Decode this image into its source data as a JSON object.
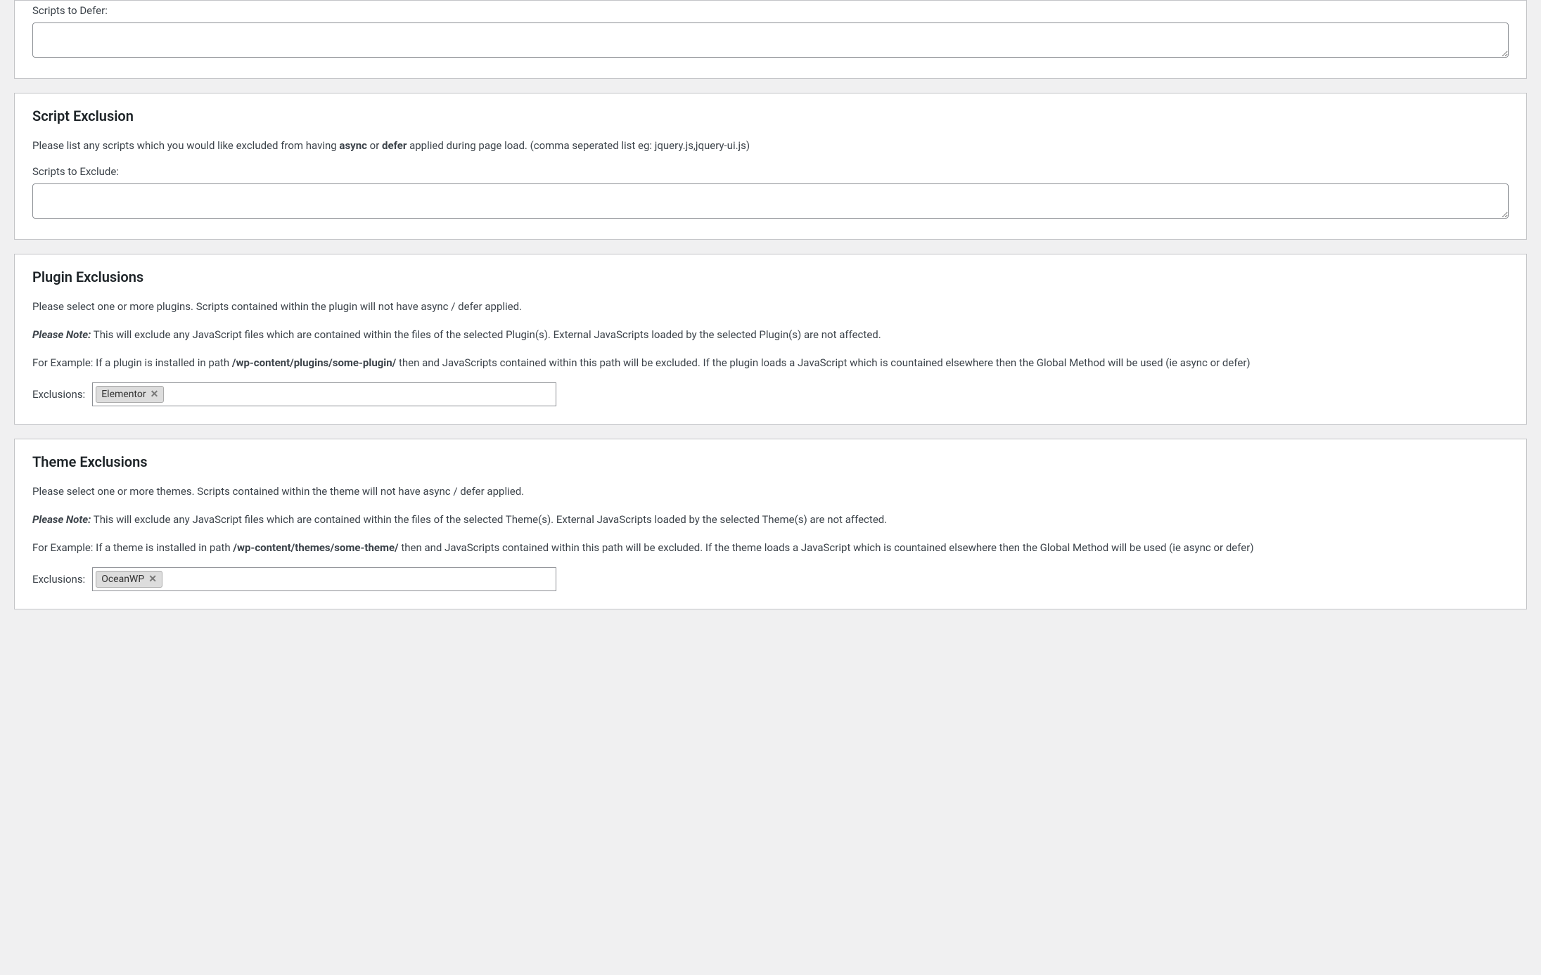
{
  "scripts_defer": {
    "label": "Scripts to Defer:",
    "value": ""
  },
  "script_exclusion": {
    "heading": "Script Exclusion",
    "desc_pre": "Please list any scripts which you would like excluded from having ",
    "desc_bold1": "async",
    "desc_mid": " or ",
    "desc_bold2": "defer",
    "desc_post": " applied during page load. (comma seperated list eg: jquery.js,jquery-ui.js)",
    "label": "Scripts to Exclude:",
    "value": ""
  },
  "plugin_exclusions": {
    "heading": "Plugin Exclusions",
    "desc": "Please select one or more plugins. Scripts contained within the plugin will not have async / defer applied.",
    "note_label": "Please Note:",
    "note_text": " This will exclude any JavaScript files which are contained within the files of the selected Plugin(s). External JavaScripts loaded by the selected Plugin(s) are not affected.",
    "example_pre": "For Example: If a plugin is installed in path ",
    "example_path": "/wp-content/plugins/some-plugin/",
    "example_post": " then and JavaScripts contained within this path will be excluded. If the plugin loads a JavaScript which is countained elsewhere then the Global Method will be used (ie async or defer)",
    "exclusions_label": "Exclusions:",
    "tags": [
      "Elementor"
    ]
  },
  "theme_exclusions": {
    "heading": "Theme Exclusions",
    "desc": "Please select one or more themes. Scripts contained within the theme will not have async / defer applied.",
    "note_label": "Please Note:",
    "note_text": " This will exclude any JavaScript files which are contained within the files of the selected Theme(s). External JavaScripts loaded by the selected Theme(s) are not affected.",
    "example_pre": "For Example: If a theme is installed in path ",
    "example_path": "/wp-content/themes/some-theme/",
    "example_post": " then and JavaScripts contained within this path will be excluded. If the theme loads a JavaScript which is countained elsewhere then the Global Method will be used (ie async or defer)",
    "exclusions_label": "Exclusions:",
    "tags": [
      "OceanWP"
    ]
  }
}
